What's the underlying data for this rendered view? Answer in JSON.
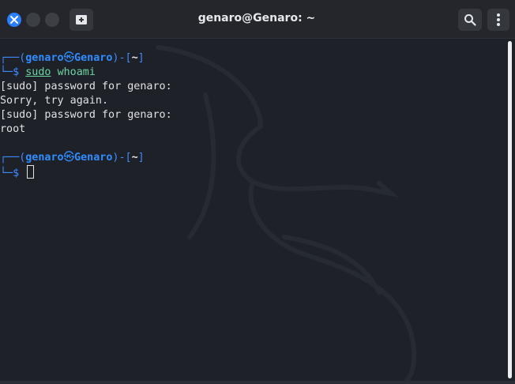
{
  "window": {
    "title": "genaro@Genaro: ~"
  },
  "titlebar": {
    "close_icon": "close-icon",
    "minimize_icon": "minimize-icon",
    "maximize_icon": "maximize-icon",
    "new_tab_icon": "new-tab-icon",
    "search_icon": "search-icon",
    "menu_icon": "kebab-menu-icon"
  },
  "colors": {
    "background": "#1e2128",
    "titlebar": "#24262c",
    "prompt_blue": "#2f8dff",
    "command_green": "#6cd4a3",
    "close_button": "#2a7fff"
  },
  "prompt": {
    "open_paren": "(",
    "user": "genaro",
    "at_symbol": "㉿",
    "host": "Genaro",
    "close_paren": ")",
    "dash": "-",
    "dir_open": "[",
    "dir": "~",
    "dir_close": "]",
    "sign": "$"
  },
  "terminal": {
    "command": "sudo",
    "argument": "whoami",
    "output": [
      "[sudo] password for genaro:",
      "Sorry, try again.",
      "[sudo] password for genaro:",
      "root"
    ]
  }
}
